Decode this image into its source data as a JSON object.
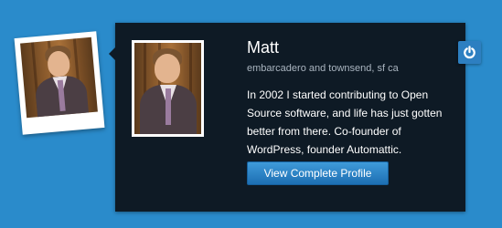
{
  "profile": {
    "name": "Matt",
    "location": "embarcadero and townsend, sf ca",
    "bio": "In 2002 I started contributing to Open Source software, and life has just gotten better from there. Co-founder of WordPress, founder Automattic.",
    "view_profile_label": "View Complete Profile"
  },
  "colors": {
    "page_background": "#2a8bcb",
    "card_background": "#0e1a25",
    "button": "#2b82c6",
    "location_text": "#a9b4bf"
  },
  "icons": {
    "power": "power-icon"
  }
}
